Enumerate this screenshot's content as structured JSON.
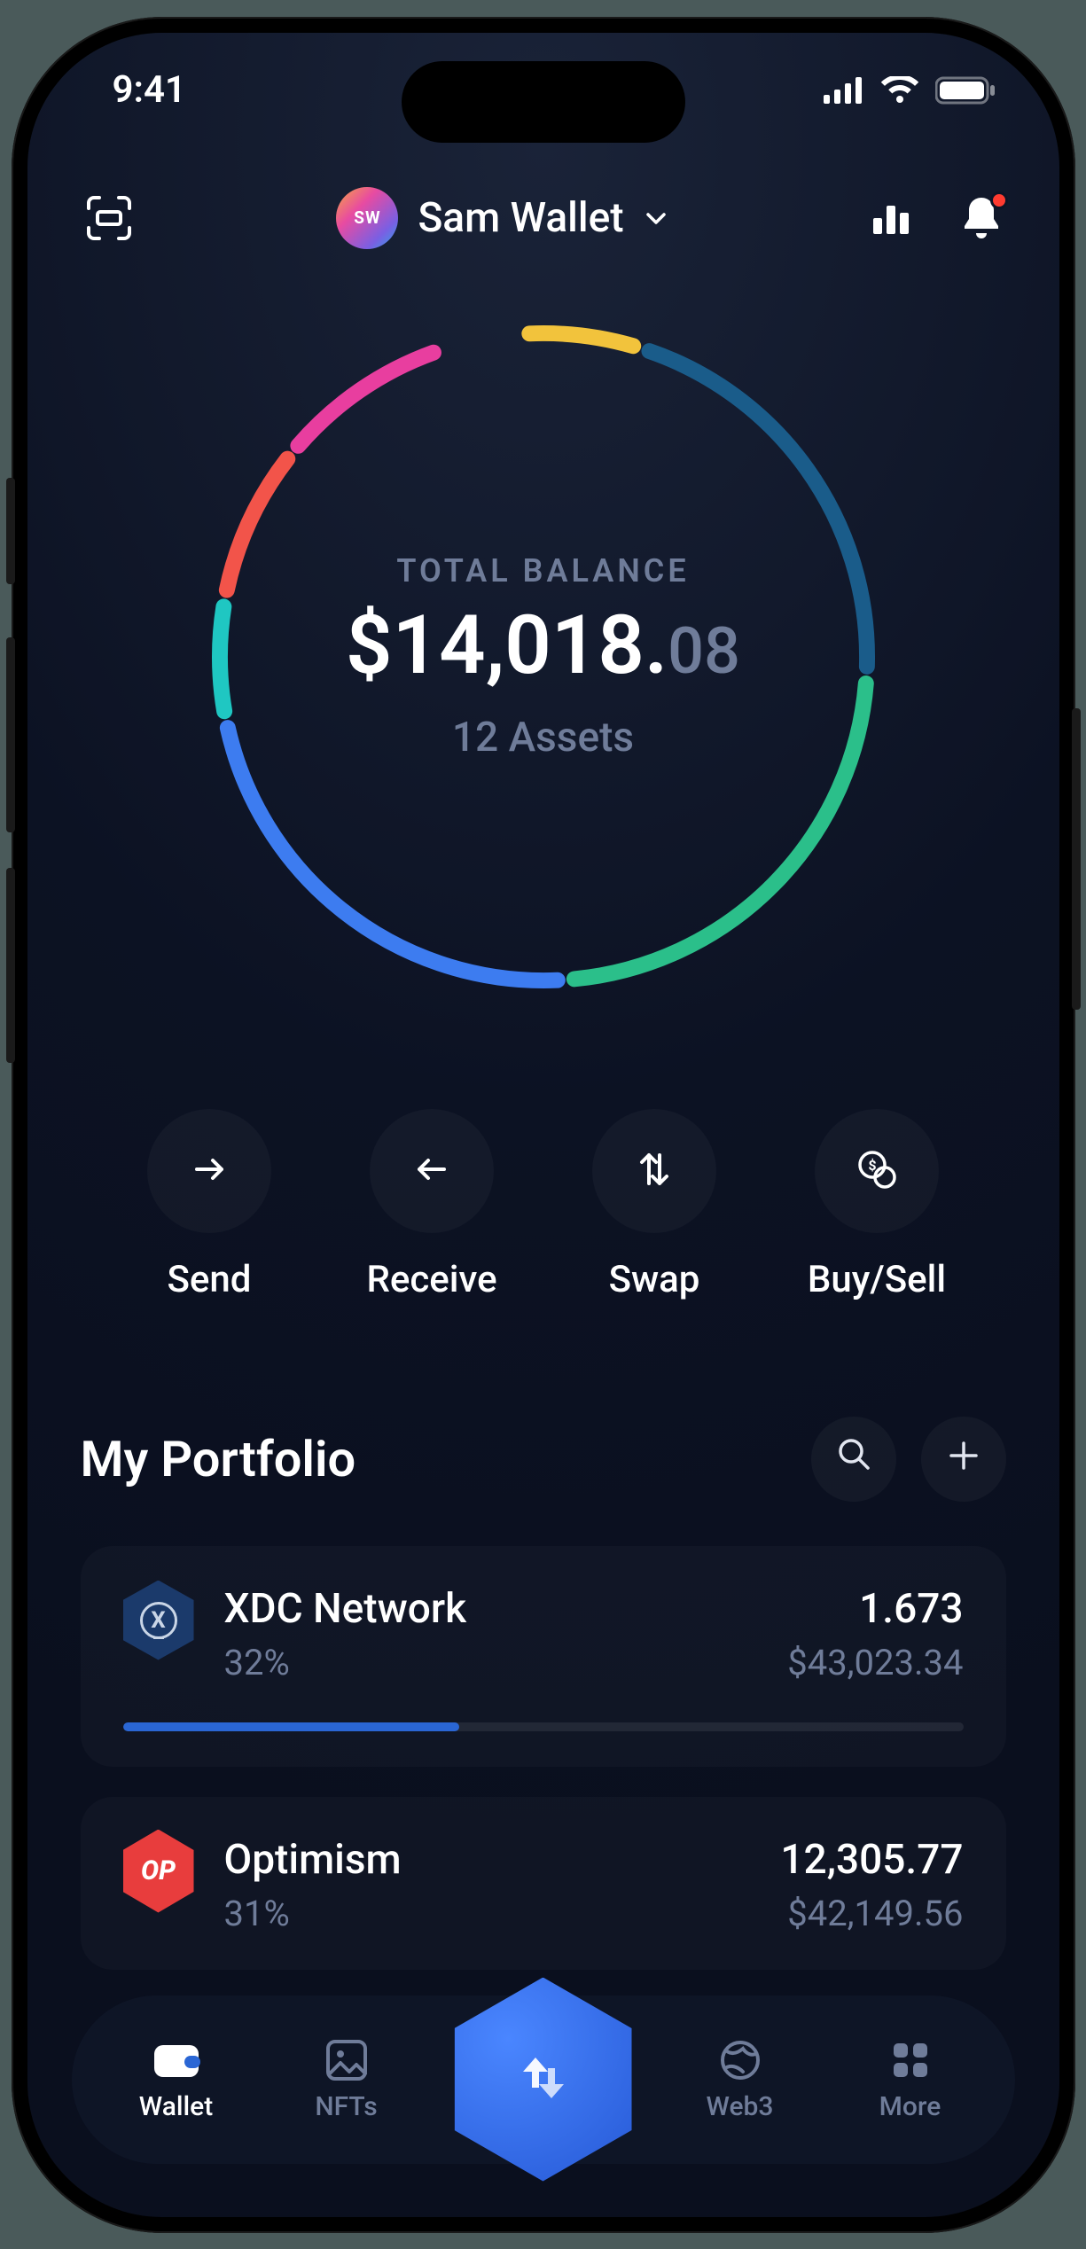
{
  "status_bar": {
    "time": "9:41"
  },
  "header": {
    "avatar_initials": "SW",
    "wallet_name": "Sam Wallet"
  },
  "balance": {
    "label": "TOTAL BALANCE",
    "amount_main": "$14,018.",
    "amount_cents": "08",
    "assets_count": "12 Assets"
  },
  "actions": [
    {
      "label": "Send"
    },
    {
      "label": "Receive"
    },
    {
      "label": "Swap"
    },
    {
      "label": "Buy/Sell"
    }
  ],
  "portfolio": {
    "title": "My Portfolio",
    "assets": [
      {
        "name": "XDC Network",
        "pct": "32%",
        "amount": "1.673",
        "value": "$43,023.34",
        "bar_pct": 40
      },
      {
        "name": "Optimism",
        "pct": "31%",
        "amount": "12,305.77",
        "value": "$42,149.56",
        "bar_pct": 0
      }
    ]
  },
  "tabbar": [
    {
      "label": "Wallet",
      "active": true
    },
    {
      "label": "NFTs",
      "active": false
    },
    {
      "label": "Web3",
      "active": false
    },
    {
      "label": "More",
      "active": false
    }
  ],
  "chart_data": {
    "type": "pie",
    "title": "",
    "segments": [
      {
        "name": "yellow",
        "color": "#f2c33c",
        "pct": 6
      },
      {
        "name": "dark-blue",
        "color": "#1a5c8a",
        "pct": 21
      },
      {
        "name": "green",
        "color": "#2bbf8a",
        "pct": 23
      },
      {
        "name": "blue",
        "color": "#3d7cf0",
        "pct": 23
      },
      {
        "name": "cyan",
        "color": "#1fc7c2",
        "pct": 6
      },
      {
        "name": "red",
        "color": "#f2544a",
        "pct": 8
      },
      {
        "name": "magenta",
        "color": "#e83e9f",
        "pct": 9
      },
      {
        "name": "gap",
        "color": "transparent",
        "pct": 4
      }
    ]
  },
  "icons": {
    "op_text": "OP",
    "xdc_text": "X"
  }
}
